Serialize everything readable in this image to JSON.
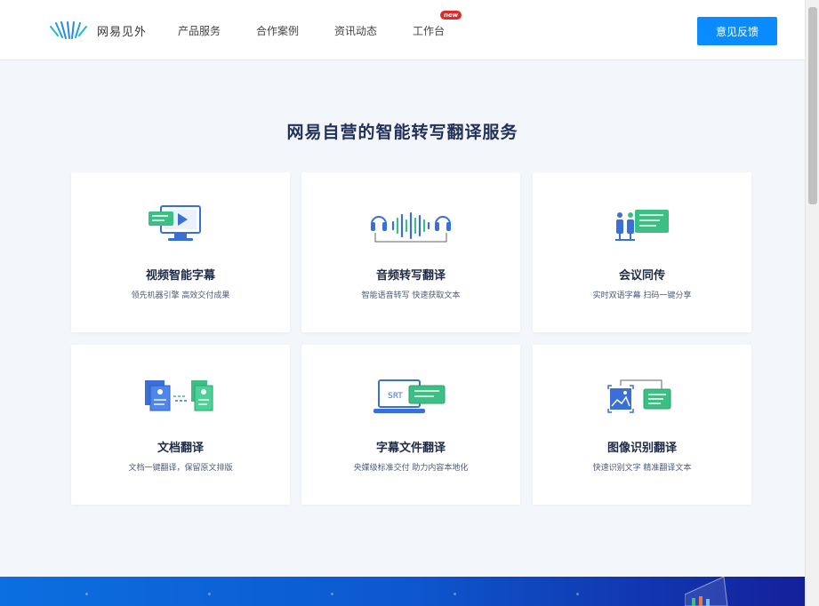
{
  "header": {
    "brand": "网易见外",
    "nav": [
      {
        "label": "产品服务"
      },
      {
        "label": "合作案例"
      },
      {
        "label": "资讯动态"
      },
      {
        "label": "工作台",
        "badge": "new"
      }
    ],
    "feedback_label": "意见反馈"
  },
  "main": {
    "title": "网易自营的智能转写翻译服务",
    "cards": [
      {
        "title": "视频智能字幕",
        "desc": "领先机器引擎 高效交付成果",
        "icon": "video-subtitle-icon"
      },
      {
        "title": "音频转写翻译",
        "desc": "智能语音转写 快速获取文本",
        "icon": "audio-transcribe-icon"
      },
      {
        "title": "会议同传",
        "desc": "实时双语字幕 扫码一键分享",
        "icon": "meeting-interpret-icon"
      },
      {
        "title": "文档翻译",
        "desc": "文档一键翻译，保留原文排版",
        "icon": "document-translate-icon"
      },
      {
        "title": "字幕文件翻译",
        "desc": "央媒级标准交付 助力内容本地化",
        "icon": "subtitle-file-icon",
        "icon_text": "SRT"
      },
      {
        "title": "图像识别翻译",
        "desc": "快速识别文字 精准翻译文本",
        "icon": "image-recognition-icon"
      }
    ]
  },
  "colors": {
    "accent": "#0a8cff",
    "title": "#22305a",
    "icon_blue": "#3a6fd8",
    "icon_green": "#3bbf85",
    "banner_start": "#0b6fe0",
    "banner_end": "#14209a"
  }
}
